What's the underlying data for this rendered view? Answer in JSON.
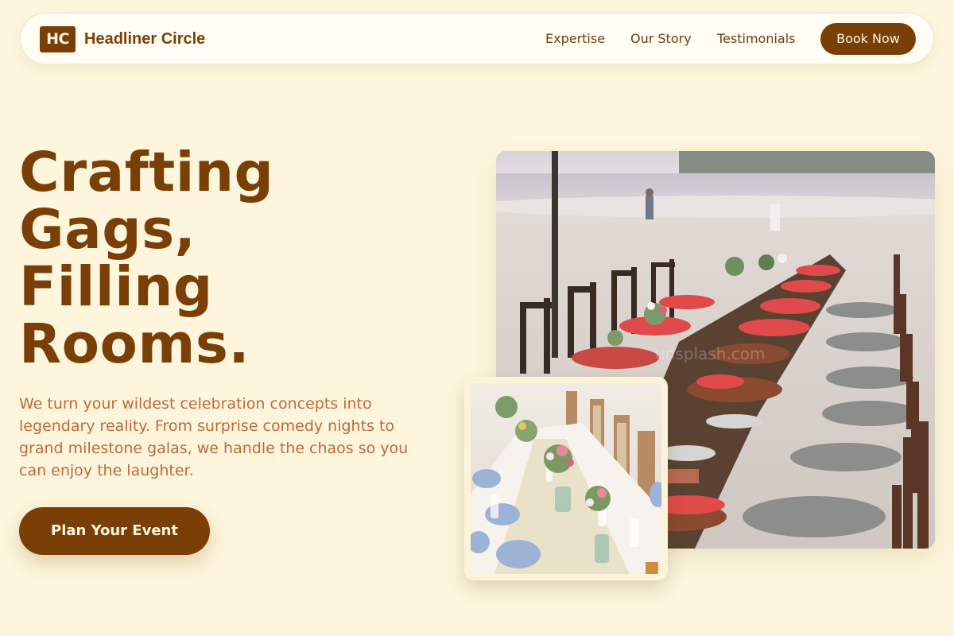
{
  "header": {
    "logo_initials": "HC",
    "brand_name": "Headliner Circle",
    "nav": {
      "expertise": "Expertise",
      "our_story": "Our Story",
      "testimonials": "Testimonials"
    },
    "cta_label": "Book Now"
  },
  "hero": {
    "title_lines": [
      "Crafting",
      "Gags,",
      "Filling",
      "Rooms."
    ],
    "description": "We turn your wildest celebration concepts into legendary reality. From surprise comedy nights to grand milestone galas, we handle the chaos so you can enjoy the laughter.",
    "cta_label": "Plan Your Event"
  },
  "colors": {
    "background": "#fdf6dc",
    "brand_brown": "#7a3f06",
    "text_orange": "#c0693a",
    "header_bg": "#fffdf3"
  }
}
